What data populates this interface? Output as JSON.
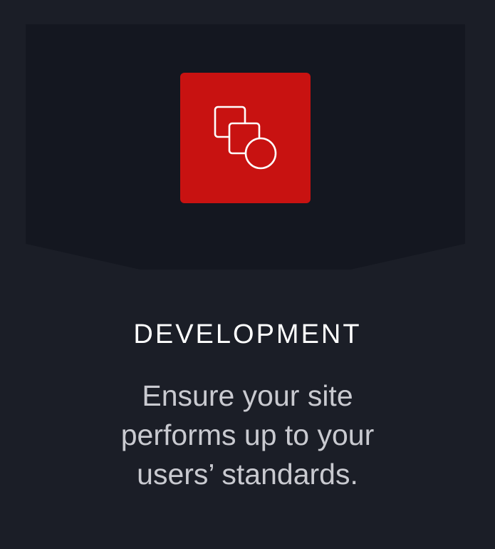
{
  "card": {
    "icon": "overlapping-shapes-icon",
    "title": "DEVELOPMENT",
    "description": "Ensure your site performs up to your users’ standards."
  },
  "colors": {
    "background": "#1b1e27",
    "banner": "#141720",
    "accent": "#c81211",
    "title": "#ffffff",
    "body_text": "#c9cad0"
  }
}
